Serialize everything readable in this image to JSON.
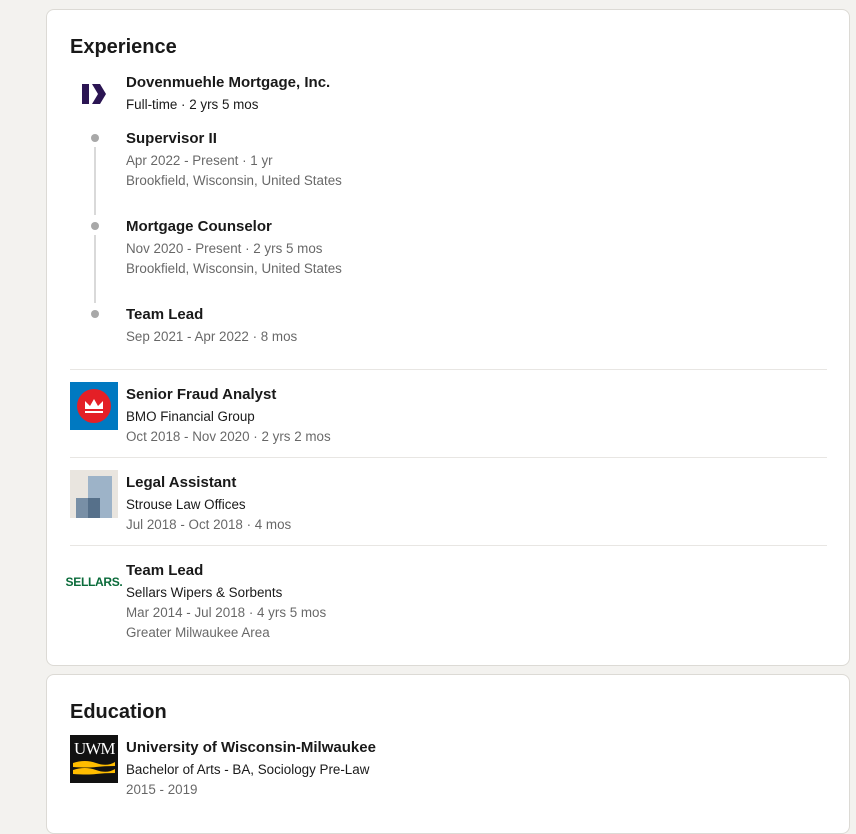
{
  "experience": {
    "title": "Experience",
    "group": {
      "company": "Dovenmuehle Mortgage, Inc.",
      "summary": "Full-time · 2 yrs 5 mos",
      "logo_icon": "dovenmuehle-logo",
      "roles": [
        {
          "title": "Supervisor II",
          "dates": "Apr 2022 - Present · 1 yr",
          "location": "Brookfield, Wisconsin, United States"
        },
        {
          "title": "Mortgage Counselor",
          "dates": "Nov 2020 - Present · 2 yrs 5 mos",
          "location": "Brookfield, Wisconsin, United States"
        },
        {
          "title": "Team Lead",
          "dates": "Sep 2021 - Apr 2022 · 8 mos"
        }
      ]
    },
    "items": [
      {
        "title": "Senior Fraud Analyst",
        "company": "BMO Financial Group",
        "dates": "Oct 2018 - Nov 2020 · 2 yrs 2 mos",
        "logo_icon": "bmo-logo"
      },
      {
        "title": "Legal Assistant",
        "company": "Strouse Law Offices",
        "dates": "Jul 2018 - Oct 2018 · 4 mos",
        "logo_icon": "placeholder-company-logo"
      },
      {
        "title": "Team Lead",
        "company": "Sellars Wipers & Sorbents",
        "dates": "Mar 2014 - Jul 2018 · 4 yrs 5 mos",
        "location": "Greater Milwaukee Area",
        "logo_icon": "sellars-logo",
        "logo_text": "SELLARS."
      }
    ]
  },
  "education": {
    "title": "Education",
    "items": [
      {
        "school": "University of Wisconsin-Milwaukee",
        "degree": "Bachelor of Arts - BA, Sociology Pre-Law",
        "dates": "2015 - 2019",
        "logo_icon": "uwm-logo",
        "logo_text": "UWM"
      }
    ]
  },
  "colors": {
    "page_bg": "#f3f2ef",
    "card_bg": "#ffffff",
    "bmo_blue": "#0079c1",
    "bmo_red": "#e41f26",
    "sellars_green": "#0a6b3a",
    "uwm_gold": "#ffbd00",
    "dovenmuehle_navy": "#2b1553"
  }
}
